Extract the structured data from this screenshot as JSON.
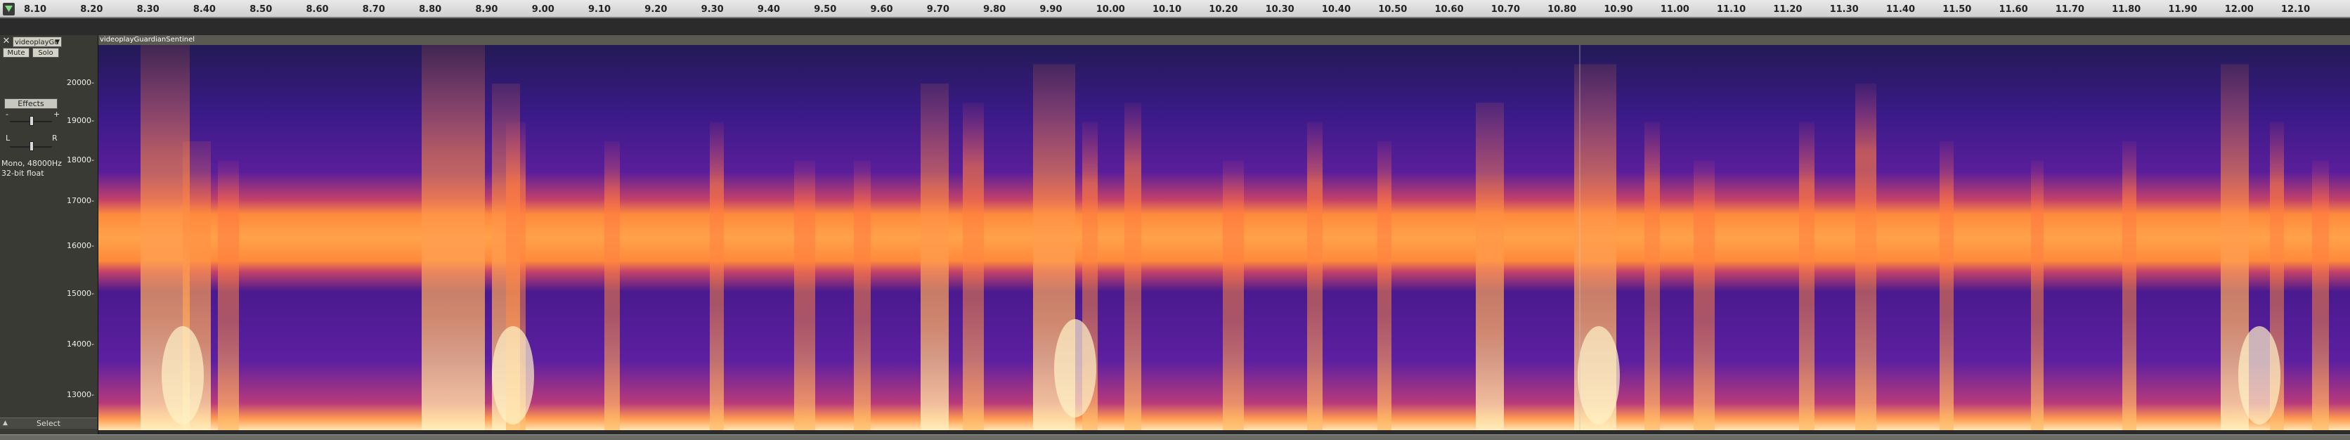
{
  "ruler": {
    "ticks": [
      "8.10",
      "8.20",
      "8.30",
      "8.40",
      "8.50",
      "8.60",
      "8.70",
      "8.80",
      "8.90",
      "9.00",
      "9.10",
      "9.20",
      "9.30",
      "9.40",
      "9.50",
      "9.60",
      "9.70",
      "9.80",
      "9.90",
      "10.00",
      "10.10",
      "10.20",
      "10.30",
      "10.40",
      "10.50",
      "10.60",
      "10.70",
      "10.80",
      "10.90",
      "11.00",
      "11.10",
      "11.20",
      "11.30",
      "11.40",
      "11.50",
      "11.60",
      "11.70",
      "11.80",
      "11.90",
      "12.00",
      "12.10"
    ]
  },
  "track": {
    "close_icon": "close-icon",
    "name_button_label": "videoplayGu",
    "mute_label": "Mute",
    "solo_label": "Solo",
    "effects_label": "Effects",
    "gain_minus": "-",
    "gain_plus": "+",
    "pan_left": "L",
    "pan_right": "R",
    "info_rate": "Mono, 48000Hz",
    "info_format": "32-bit float",
    "select_label": "Select",
    "title": "videoplayGuardianSentinel"
  },
  "freq_scale": {
    "labels": [
      "20000-",
      "19000-",
      "18000-",
      "17000-",
      "16000-",
      "15000-",
      "14000-",
      "13000-"
    ]
  },
  "colors": {
    "spectro_bg": "#21184a",
    "band_core": "#ff9a40",
    "band_edge": "#c0406a",
    "bright": "#fff4c8"
  }
}
